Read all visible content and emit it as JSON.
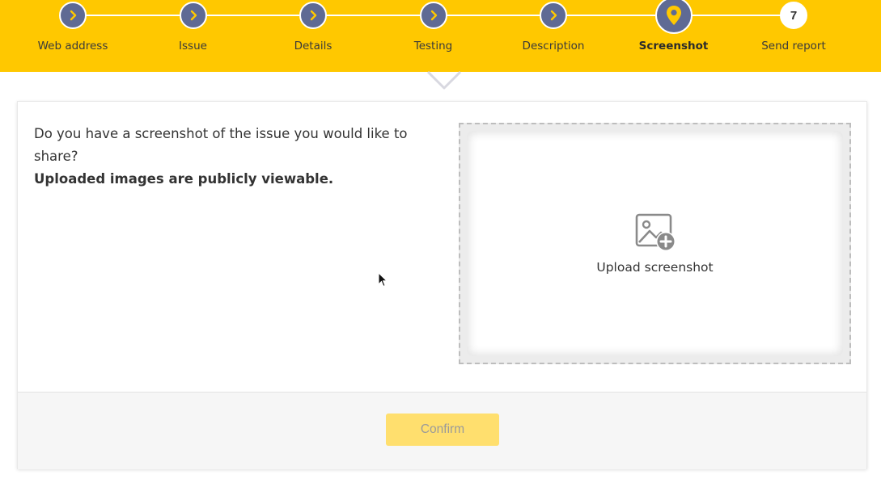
{
  "stepper": {
    "steps": [
      {
        "label": "Web address",
        "state": "done"
      },
      {
        "label": "Issue",
        "state": "done"
      },
      {
        "label": "Details",
        "state": "done"
      },
      {
        "label": "Testing",
        "state": "done"
      },
      {
        "label": "Description",
        "state": "done"
      },
      {
        "label": "Screenshot",
        "state": "current"
      },
      {
        "label": "Send report",
        "state": "pending",
        "number": "7"
      }
    ],
    "icons": {
      "done": "chevron-right-icon",
      "current": "map-pin-icon"
    }
  },
  "content": {
    "question": "Do you have a screenshot of the issue you would like to share?",
    "note": "Uploaded images are publicly viewable."
  },
  "upload": {
    "label": "Upload screenshot",
    "icon": "image-add-icon"
  },
  "footer": {
    "confirm_label": "Confirm"
  },
  "colors": {
    "brand_yellow": "#ffc800",
    "step_circle": "#5f6a94",
    "step_chevron": "#ffc800",
    "confirm_disabled": "#ffdf6e"
  }
}
